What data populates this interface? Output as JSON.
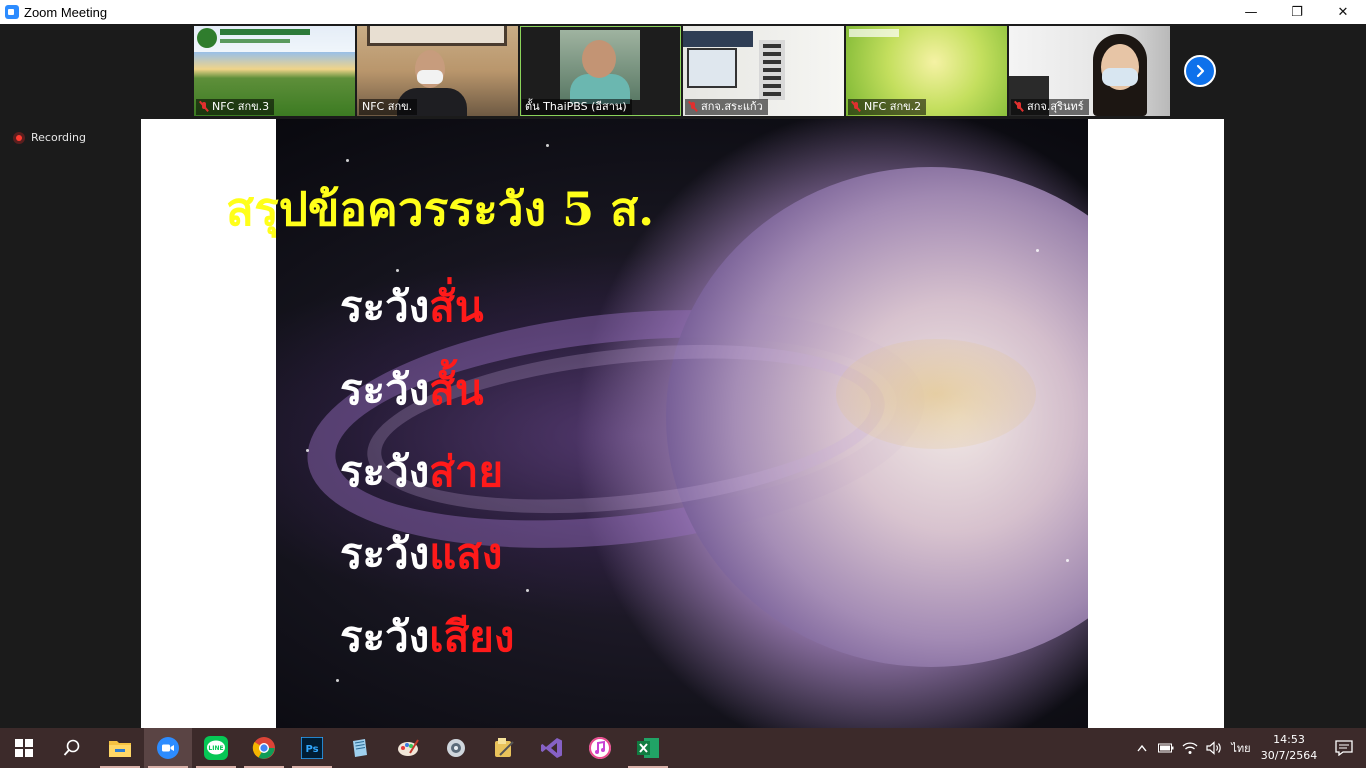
{
  "window": {
    "title": "Zoom Meeting",
    "minimize_glyph": "—",
    "restore_glyph": "❐",
    "close_glyph": "✕"
  },
  "participants": [
    {
      "name": "NFC สกข.3",
      "muted": true
    },
    {
      "name": "NFC สกข.",
      "muted": false
    },
    {
      "name": "ตั้น ThaiPBS (อีสาน)",
      "muted": false,
      "active_speaker": true
    },
    {
      "name": "สกจ.สระแก้ว",
      "muted": true
    },
    {
      "name": "NFC สกข.2",
      "muted": true
    },
    {
      "name": "สกจ.สุรินทร์",
      "muted": true
    }
  ],
  "recording": {
    "label": "Recording"
  },
  "slide": {
    "title": "สรุปข้อควรระวัง 5 ส.",
    "items": [
      {
        "prefix": "ระวัง",
        "highlight": "สั่น"
      },
      {
        "prefix": "ระวัง",
        "highlight": "สั้น"
      },
      {
        "prefix": "ระวัง",
        "highlight": "ส่าย"
      },
      {
        "prefix": "ระวัง",
        "highlight": "แสง"
      },
      {
        "prefix": "ระวัง",
        "highlight": "เสียง"
      }
    ],
    "title_color": "#ffff1a",
    "highlight_color": "#ff1a1a"
  },
  "taskbar": {
    "apps": [
      "start-icon",
      "search-icon",
      "file-explorer-icon",
      "zoom-icon",
      "line-icon",
      "chrome-icon",
      "photoshop-icon",
      "notepad-icon",
      "paint-icon",
      "photos-icon",
      "tools-icon",
      "visual-studio-icon",
      "itunes-icon",
      "excel-icon"
    ],
    "line_label": "LINE",
    "ps_label": "Ps"
  },
  "tray": {
    "language": "ไทย",
    "time": "14:53",
    "date": "30/7/2564"
  },
  "colors": {
    "zoom_blue": "#2d8cff",
    "taskbar": "#3c2a2a",
    "recording_red": "#ff3b30"
  }
}
